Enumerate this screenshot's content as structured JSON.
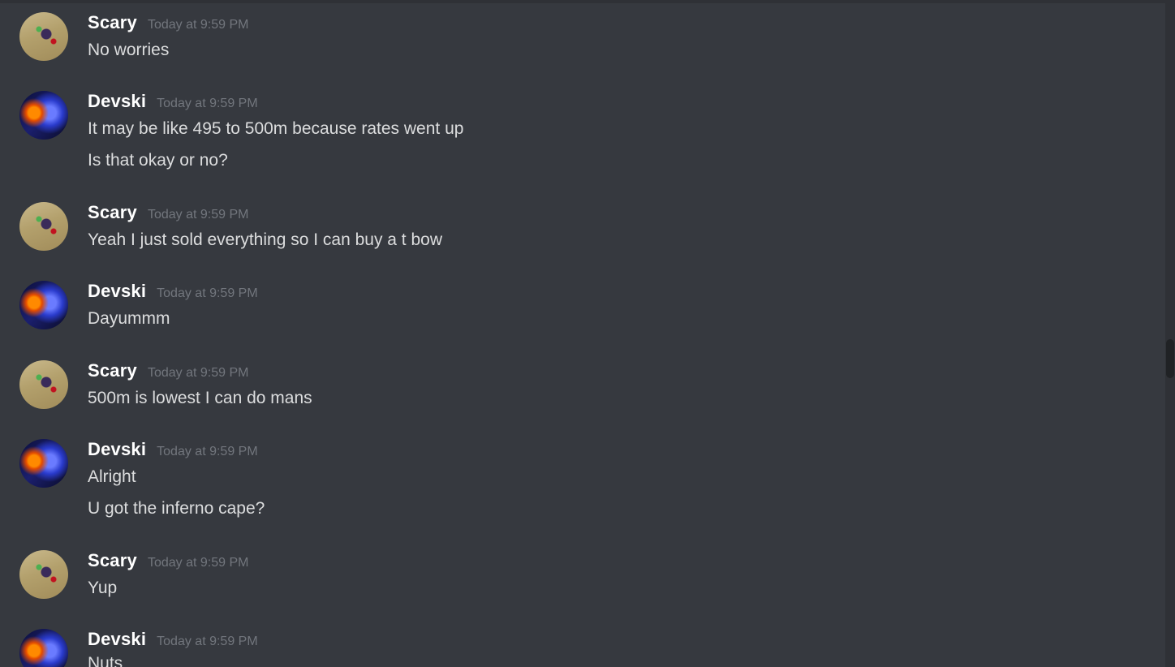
{
  "messages": [
    {
      "author": "Scary",
      "time": "Today at 9:59 PM",
      "avatar": "scary-avatar",
      "lines": [
        "No worries"
      ]
    },
    {
      "author": "Devski",
      "time": "Today at 9:59 PM",
      "avatar": "devski-avatar",
      "lines": [
        "It may be like 495 to 500m because rates went up",
        "Is that okay or no?"
      ]
    },
    {
      "author": "Scary",
      "time": "Today at 9:59 PM",
      "avatar": "scary-avatar",
      "lines": [
        "Yeah I just sold everything so I can buy a t bow"
      ]
    },
    {
      "author": "Devski",
      "time": "Today at 9:59 PM",
      "avatar": "devski-avatar",
      "lines": [
        "Dayummm"
      ]
    },
    {
      "author": "Scary",
      "time": "Today at 9:59 PM",
      "avatar": "scary-avatar",
      "lines": [
        "500m is lowest I can do mans"
      ]
    },
    {
      "author": "Devski",
      "time": "Today at 9:59 PM",
      "avatar": "devski-avatar",
      "lines": [
        "Alright",
        "U got the inferno cape?"
      ]
    },
    {
      "author": "Scary",
      "time": "Today at 9:59 PM",
      "avatar": "scary-avatar",
      "lines": [
        "Yup"
      ]
    },
    {
      "author": "Devski",
      "time": "Today at 9:59 PM",
      "avatar": "devski-avatar",
      "lines": [
        "Nuts"
      ]
    }
  ],
  "colors": {
    "background": "#36393f",
    "username": "#ffffff",
    "timestamp": "#72767d",
    "message_text": "#dcddde"
  }
}
